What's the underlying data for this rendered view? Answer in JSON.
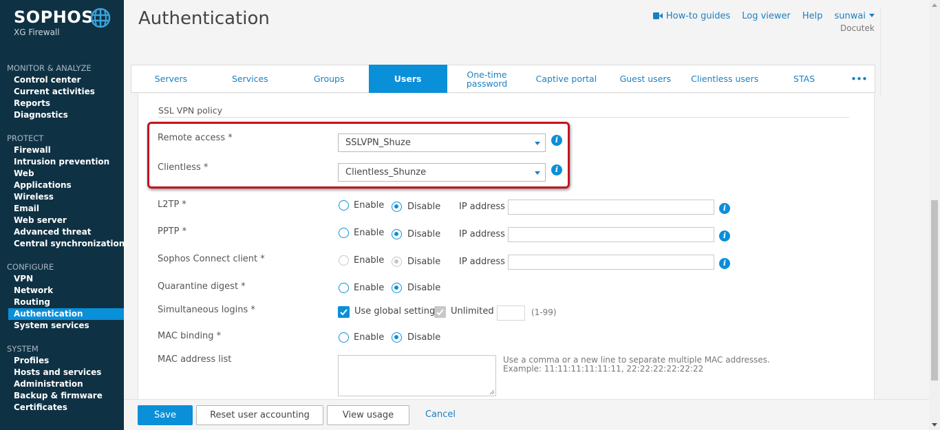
{
  "brand": {
    "name": "SOPHOS",
    "product": "XG Firewall"
  },
  "sidebar": {
    "sections": [
      {
        "heading": "MONITOR & ANALYZE",
        "items": [
          "Control center",
          "Current activities",
          "Reports",
          "Diagnostics"
        ]
      },
      {
        "heading": "PROTECT",
        "items": [
          "Firewall",
          "Intrusion prevention",
          "Web",
          "Applications",
          "Wireless",
          "Email",
          "Web server",
          "Advanced threat",
          "Central synchronization"
        ]
      },
      {
        "heading": "CONFIGURE",
        "items": [
          "VPN",
          "Network",
          "Routing",
          "Authentication",
          "System services"
        ]
      },
      {
        "heading": "SYSTEM",
        "items": [
          "Profiles",
          "Hosts and services",
          "Administration",
          "Backup & firmware",
          "Certificates"
        ]
      }
    ],
    "active_item": "Authentication"
  },
  "header": {
    "title": "Authentication",
    "links": {
      "howto": "How-to guides",
      "logviewer": "Log viewer",
      "help": "Help",
      "user": "sunwai"
    },
    "company": "Docutek"
  },
  "tabs": [
    "Servers",
    "Services",
    "Groups",
    "Users",
    "One-time password",
    "Captive portal",
    "Guest users",
    "Clientless users",
    "STAS",
    "•••"
  ],
  "active_tab": "Users",
  "form": {
    "section_title": "SSL VPN policy",
    "remote_access": {
      "label": "Remote access *",
      "value": "SSLVPN_Shuze"
    },
    "clientless": {
      "label": "Clientless *",
      "value": "Clientless_Shunze"
    },
    "l2tp": {
      "label": "L2TP *",
      "enable": "Enable",
      "disable": "Disable",
      "ip_label": "IP address",
      "selected": "Disable"
    },
    "pptp": {
      "label": "PPTP *",
      "enable": "Enable",
      "disable": "Disable",
      "ip_label": "IP address",
      "selected": "Disable"
    },
    "sophos_connect": {
      "label": "Sophos Connect client *",
      "enable": "Enable",
      "disable": "Disable",
      "ip_label": "IP address",
      "selected": "Disable",
      "disabled": true
    },
    "quarantine": {
      "label": "Quarantine digest *",
      "enable": "Enable",
      "disable": "Disable",
      "selected": "Disable"
    },
    "simultaneous": {
      "label": "Simultaneous logins *",
      "global": "Use global setting",
      "unlimited": "Unlimited",
      "range": "(1-99)",
      "global_checked": true,
      "unlimited_checked": true
    },
    "mac_binding": {
      "label": "MAC binding *",
      "enable": "Enable",
      "disable": "Disable",
      "selected": "Disable"
    },
    "mac_list": {
      "label": "MAC address list",
      "hint1": "Use a comma or a new line to separate multiple MAC addresses.",
      "hint2": "Example: 11:11:11:11:11:11, 22:22:22:22:22:22"
    }
  },
  "footer": {
    "save": "Save",
    "reset": "Reset user accounting",
    "view_usage": "View usage",
    "cancel": "Cancel"
  },
  "colors": {
    "sidebar_bg": "#0f3144",
    "accent": "#0a8fd9",
    "highlight": "#c4121f"
  }
}
